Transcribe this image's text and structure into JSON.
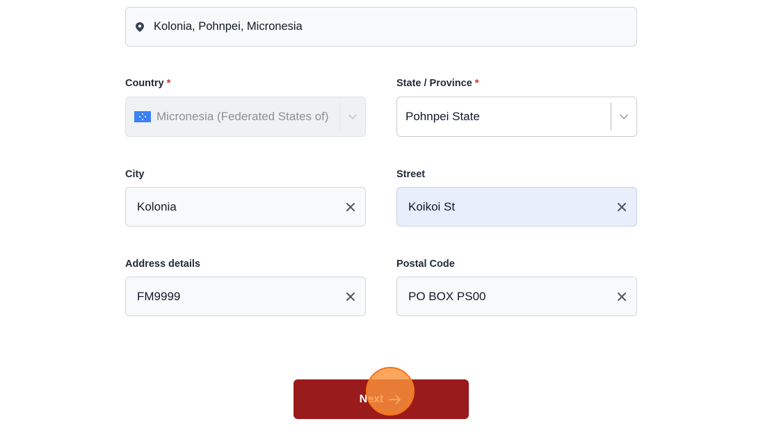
{
  "location": {
    "value": "Kolonia, Pohnpei, Micronesia",
    "icon": "map-pin-icon"
  },
  "form": {
    "country": {
      "label": "Country",
      "required_mark": "*",
      "value": "Micronesia (Federated States of)",
      "flag": "micronesia-flag-icon",
      "disabled": true
    },
    "state": {
      "label": "State / Province",
      "required_mark": "*",
      "value": "Pohnpei State"
    },
    "city": {
      "label": "City",
      "value": "Kolonia"
    },
    "street": {
      "label": "Street",
      "value": "Koikoi St"
    },
    "address_details": {
      "label": "Address details",
      "value": "FM9999"
    },
    "postal_code": {
      "label": "Postal Code",
      "value": "PO BOX PS00"
    }
  },
  "actions": {
    "next_label": "Next"
  },
  "colors": {
    "accent": "#991b1b",
    "required": "#dc2626",
    "highlight_field": "#e8eefc",
    "click_indicator": "#f97316"
  }
}
